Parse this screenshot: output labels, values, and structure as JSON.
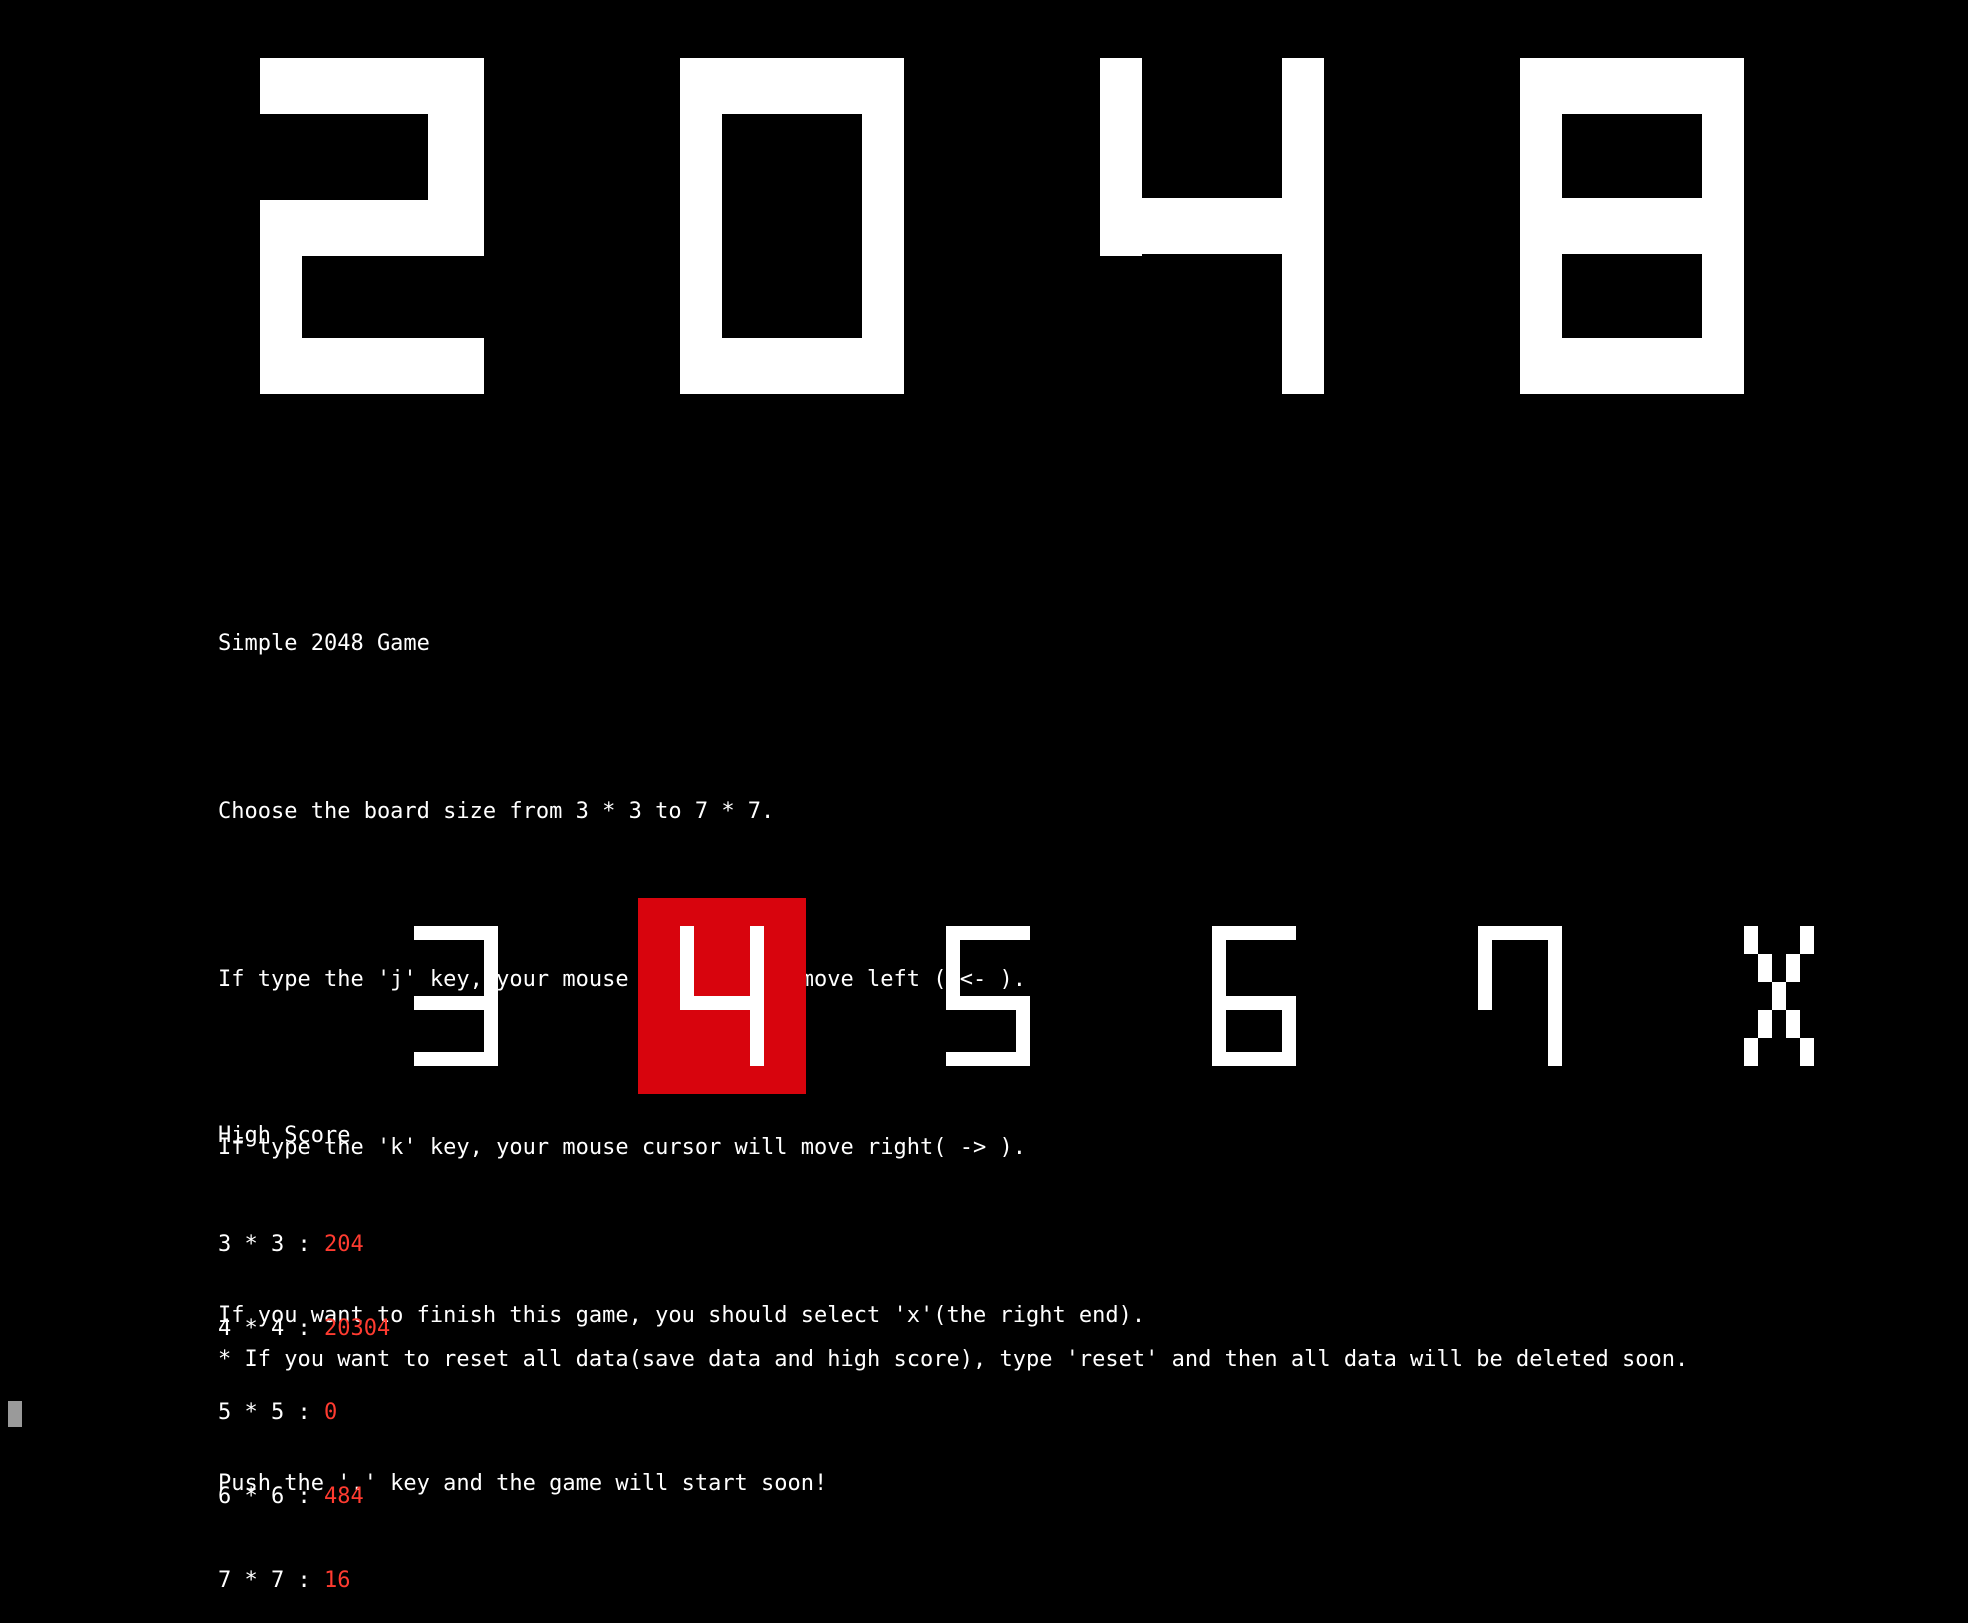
{
  "title_digits": [
    "2",
    "0",
    "4",
    "8"
  ],
  "intro": {
    "heading": "Simple 2048 Game",
    "lines": [
      "Choose the board size from 3 * 3 to 7 * 7.",
      "If type the 'j' key, your mouse cursor will move left ( <- ).",
      "If type the 'k' key, your mouse cursor will move right( -> ).",
      "If you want to finish this game, you should select 'x'(the right end).",
      "Push the '.' key and the game will start soon!"
    ]
  },
  "size_selector": {
    "options": [
      "3",
      "4",
      "5",
      "6",
      "7",
      "X"
    ],
    "selected_index": 1,
    "selected_color": "#d8040d"
  },
  "high_score": {
    "title": "High Score",
    "rows": [
      {
        "label": "3 * 3 : ",
        "value": "204"
      },
      {
        "label": "4 * 4 : ",
        "value": "20304"
      },
      {
        "label": "5 * 5 : ",
        "value": "0"
      },
      {
        "label": "6 * 6 : ",
        "value": "484"
      },
      {
        "label": "7 * 7 : ",
        "value": "16"
      }
    ],
    "value_color": "#ff3b30"
  },
  "reset_note": "* If you want to reset all data(save data and high score), type 'reset' and then all data will be deleted soon."
}
